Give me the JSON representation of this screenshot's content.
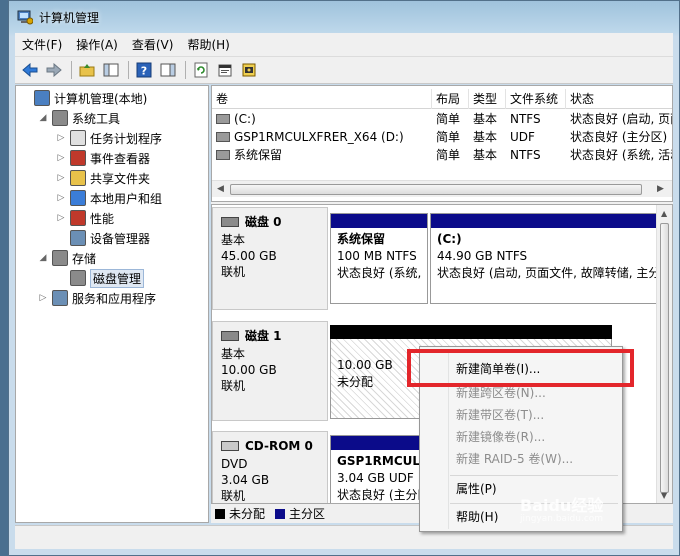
{
  "window": {
    "title": "计算机管理"
  },
  "menu": [
    "文件(F)",
    "操作(A)",
    "查看(V)",
    "帮助(H)"
  ],
  "tree": {
    "items": [
      {
        "label": "计算机管理(本地)",
        "level": 0,
        "expander": "",
        "icon": "computer-management-icon"
      },
      {
        "label": "系统工具",
        "level": 1,
        "expander": "◢",
        "icon": "tools-icon"
      },
      {
        "label": "任务计划程序",
        "level": 2,
        "expander": "▷",
        "icon": "clock-icon"
      },
      {
        "label": "事件查看器",
        "level": 2,
        "expander": "▷",
        "icon": "event-viewer-icon"
      },
      {
        "label": "共享文件夹",
        "level": 2,
        "expander": "▷",
        "icon": "shared-folder-icon"
      },
      {
        "label": "本地用户和组",
        "level": 2,
        "expander": "▷",
        "icon": "users-icon"
      },
      {
        "label": "性能",
        "level": 2,
        "expander": "▷",
        "icon": "performance-icon"
      },
      {
        "label": "设备管理器",
        "level": 2,
        "expander": "",
        "icon": "device-manager-icon"
      },
      {
        "label": "存储",
        "level": 1,
        "expander": "◢",
        "icon": "storage-icon"
      },
      {
        "label": "磁盘管理",
        "level": 2,
        "expander": "",
        "icon": "disk-management-icon",
        "selected": true
      },
      {
        "label": "服务和应用程序",
        "level": 1,
        "expander": "▷",
        "icon": "services-icon"
      }
    ]
  },
  "volumes": {
    "headers": [
      "卷",
      "布局",
      "类型",
      "文件系统",
      "状态"
    ],
    "rows": [
      [
        "(C:)",
        "简单",
        "基本",
        "NTFS",
        "状态良好 (启动, 页面"
      ],
      [
        "GSP1RMCULXFRER_X64 (D:)",
        "简单",
        "基本",
        "UDF",
        "状态良好 (主分区)"
      ],
      [
        "系统保留",
        "简单",
        "基本",
        "NTFS",
        "状态良好 (系统, 活动"
      ]
    ]
  },
  "disks": [
    {
      "name": "磁盘 0",
      "type": "基本",
      "size": "45.00 GB",
      "state": "联机",
      "partitions": [
        {
          "name": "系统保留",
          "detail": "100 MB NTFS",
          "status": "状态良好 (系统,",
          "bar": "primary"
        },
        {
          "name": "(C:)",
          "detail": "44.90 GB NTFS",
          "status": "状态良好 (启动, 页面文件, 故障转储, 主分",
          "bar": "primary"
        }
      ]
    },
    {
      "name": "磁盘 1",
      "type": "基本",
      "size": "10.00 GB",
      "state": "联机",
      "partitions": [
        {
          "name": "",
          "detail": "10.00 GB",
          "status": "未分配",
          "bar": "unallocated"
        }
      ]
    },
    {
      "name": "CD-ROM 0",
      "type": "DVD",
      "size": "3.04 GB",
      "state": "联机",
      "partitions": [
        {
          "name": "GSP1RMCULXFR",
          "detail": "3.04 GB UDF",
          "status": "状态良好 (主分区)",
          "bar": "primary"
        }
      ]
    }
  ],
  "legend": [
    {
      "label": "未分配",
      "color": "#000000"
    },
    {
      "label": "主分区",
      "color": "#0b0b8a"
    }
  ],
  "context_menu": {
    "items": [
      {
        "label": "新建简单卷(I)...",
        "enabled": true
      },
      {
        "label": "新建跨区卷(N)...",
        "enabled": false
      },
      {
        "label": "新建带区卷(T)...",
        "enabled": false
      },
      {
        "label": "新建镜像卷(R)...",
        "enabled": false
      },
      {
        "label": "新建 RAID-5 卷(W)...",
        "enabled": false
      },
      {
        "label": "属性(P)",
        "enabled": true
      },
      {
        "label": "帮助(H)",
        "enabled": true
      }
    ]
  },
  "watermark": {
    "text": "Baidu经验",
    "sub": "jingyan.baidu.com"
  },
  "colors": {
    "primary_partition": "#0b0b8a",
    "unallocated": "#000000",
    "highlight": "#e3262b",
    "selection": "#dfe8f3"
  }
}
